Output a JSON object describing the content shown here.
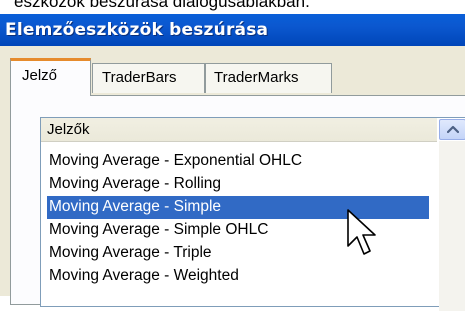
{
  "caption": "eszközök beszúrása dialógusablakban.",
  "window": {
    "title": "Elemzőeszközök beszúrása"
  },
  "tabs": [
    {
      "label": "Jelző",
      "active": true
    },
    {
      "label": "TraderBars",
      "active": false
    },
    {
      "label": "TraderMarks",
      "active": false
    }
  ],
  "list": {
    "header": "Jelzők",
    "items": [
      "Moving Average - Exponential OHLC",
      "Moving Average - Rolling",
      "Moving Average - Simple",
      "Moving Average - Simple OHLC",
      "Moving Average - Triple",
      "Moving Average - Weighted"
    ],
    "selected_item": "Moving Average - Simple"
  },
  "colors": {
    "titlebar": "#0b57cf",
    "selection": "#316ac5",
    "active_tab_accent": "#e68b2c",
    "dialog_background": "#ece9d8"
  },
  "icons": {
    "scroll_up": "chevron-up-icon",
    "pointer": "arrow-cursor-icon"
  }
}
